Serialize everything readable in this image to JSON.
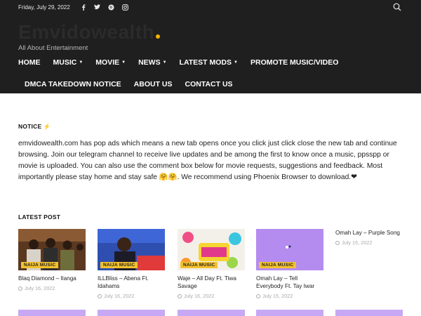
{
  "topbar": {
    "date": "Friday, July 29, 2022",
    "social_icons": [
      "facebook-icon",
      "twitter-icon",
      "pinterest-icon",
      "instagram-icon"
    ],
    "search_icon": "search-icon"
  },
  "brand": {
    "logo_text": "Emvidowealth",
    "tagline": "All About Entertainment",
    "accent_color": "#f4b400"
  },
  "nav": {
    "row1": [
      {
        "label": "HOME",
        "dropdown": false
      },
      {
        "label": "MUSIC",
        "dropdown": true
      },
      {
        "label": "MOVIE",
        "dropdown": true
      },
      {
        "label": "NEWS",
        "dropdown": true
      },
      {
        "label": "LATEST MODS",
        "dropdown": true
      },
      {
        "label": "PROMOTE MUSIC/VIDEO",
        "dropdown": false
      }
    ],
    "row2": [
      {
        "label": "DMCA TAKEDOWN NOTICE"
      },
      {
        "label": "ABOUT US"
      },
      {
        "label": "CONTACT US"
      }
    ]
  },
  "notice": {
    "title": "NOTICE",
    "title_icon": "⚡",
    "text": "emvidowealth.com has pop ads which means a new tab opens once you click just click close the new tab and continue browsing. Join our telegram channel to receive live updates and be among the first to know once a music, ppsspp or movie is uploaded. You can also use the comment box below for movie requests, suggestions and feedback. Most importantly please stay home and stay safe 🤗🤗. We recommend using Phoenix Browser to download.❤"
  },
  "latest": {
    "title": "LATEST POST",
    "posts": [
      {
        "title": "Blaq Diamond – Ilanga",
        "date": "July 16, 2022",
        "badge": "NAIJA MUSIC"
      },
      {
        "title": "ILLBliss – Abena Ft. Idahams",
        "date": "July 16, 2022",
        "badge": "NAIJA MUSIC"
      },
      {
        "title": "Waje – All Day Ft. Tiwa Savage",
        "date": "July 16, 2022",
        "badge": "NAIJA MUSIC"
      },
      {
        "title": "Omah Lay – Tell Everybody Ft. Tay Iwar",
        "date": "July 15, 2022",
        "badge": "NAIJA MUSIC"
      },
      {
        "title": "Omah Lay – Purple Song",
        "date": "July 15, 2022",
        "badge": ""
      }
    ]
  }
}
